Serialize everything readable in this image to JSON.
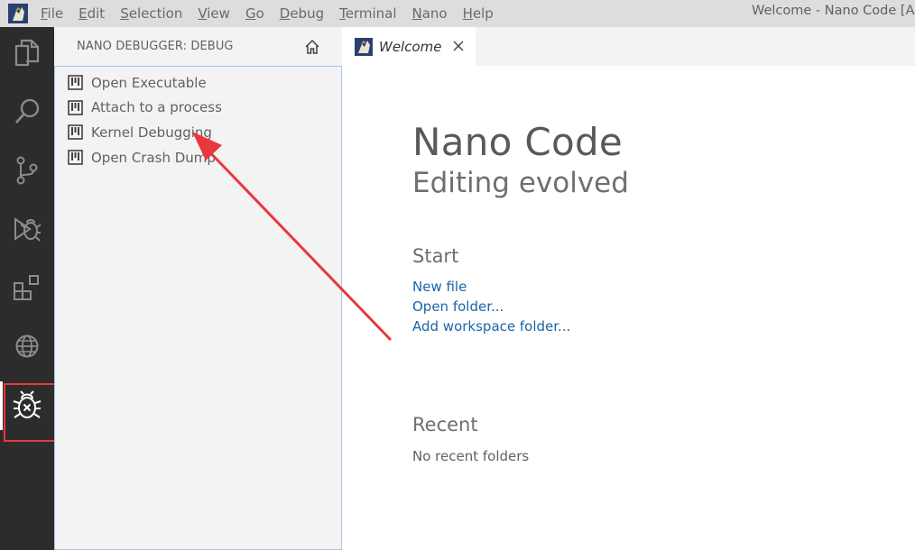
{
  "menubar": {
    "items": [
      {
        "label": "File",
        "accesskey": "F",
        "rest": "ile"
      },
      {
        "label": "Edit",
        "accesskey": "E",
        "rest": "dit"
      },
      {
        "label": "Selection",
        "accesskey": "S",
        "rest": "election"
      },
      {
        "label": "View",
        "accesskey": "V",
        "rest": "iew"
      },
      {
        "label": "Go",
        "accesskey": "G",
        "rest": "o"
      },
      {
        "label": "Debug",
        "accesskey": "D",
        "rest": "ebug"
      },
      {
        "label": "Terminal",
        "accesskey": "T",
        "rest": "erminal"
      },
      {
        "label": "Nano",
        "accesskey": "N",
        "rest": "ano"
      },
      {
        "label": "Help",
        "accesskey": "H",
        "rest": "elp"
      }
    ],
    "window_title": "Welcome - Nano Code [Adr"
  },
  "activitybar": {
    "icons": [
      "explorer-icon",
      "search-icon",
      "source-control-icon",
      "debug-icon",
      "extensions-icon",
      "globe-icon",
      "nano-debugger-icon"
    ],
    "active": "nano-debugger-icon"
  },
  "sidebar": {
    "title": "NANO DEBUGGER: DEBUG",
    "items": [
      {
        "label": "Open Executable"
      },
      {
        "label": "Attach to a process"
      },
      {
        "label": "Kernel Debugging"
      },
      {
        "label": "Open Crash Dump"
      }
    ]
  },
  "tabs": [
    {
      "label": "Welcome",
      "italic": true
    }
  ],
  "welcome": {
    "title": "Nano Code",
    "subtitle": "Editing evolved",
    "start_heading": "Start",
    "start_links": [
      "New file",
      "Open folder...",
      "Add workspace folder..."
    ],
    "recent_heading": "Recent",
    "recent_empty": "No recent folders"
  },
  "colors": {
    "activitybar_bg": "#2c2c2c",
    "sidebar_bg": "#f3f3f3",
    "link": "#1a65a8",
    "annotation": "#e8383d"
  }
}
